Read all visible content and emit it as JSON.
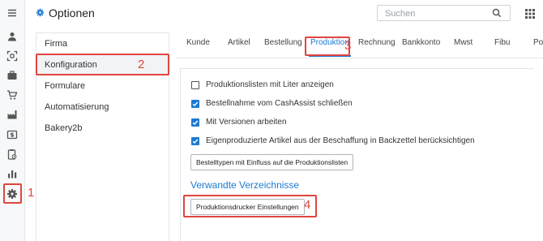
{
  "header": {
    "title": "Optionen",
    "search_placeholder": "Suchen"
  },
  "rail": {
    "icons": [
      "menu-icon",
      "user-icon",
      "scan-icon",
      "briefcase-icon",
      "cart-icon",
      "factory-icon",
      "cash-icon",
      "clipboard-clock-icon",
      "bar-chart-icon",
      "gear-icon"
    ]
  },
  "nav": {
    "items": [
      {
        "label": "Firma"
      },
      {
        "label": "Konfiguration"
      },
      {
        "label": "Formulare"
      },
      {
        "label": "Automatisierung"
      },
      {
        "label": "Bakery2b"
      }
    ]
  },
  "tabs": [
    {
      "label": "Kunde"
    },
    {
      "label": "Artikel"
    },
    {
      "label": "Bestellung"
    },
    {
      "label": "Produktion"
    },
    {
      "label": "Rechnung"
    },
    {
      "label": "Bankkonto"
    },
    {
      "label": "Mwst"
    },
    {
      "label": "Fibu"
    },
    {
      "label": "Po"
    }
  ],
  "options": [
    {
      "label": "Produktionslisten mit Liter anzeigen",
      "checked": false
    },
    {
      "label": "Bestellnahme vom CashAssist schließen",
      "checked": true
    },
    {
      "label": "Mit Versionen arbeiten",
      "checked": true
    },
    {
      "label": "Eigenproduzierte Artikel aus der Beschaffung in Backzettel berücksichtigen",
      "checked": true
    }
  ],
  "buttons": {
    "order_types": "Bestelltypen mit Einfluss auf die Produktionslisten",
    "printer_settings": "Produktionsdrucker Einstellungen"
  },
  "section": {
    "related_dirs": "Verwandte Verzeichnisse"
  },
  "annotations": {
    "n1": "1",
    "n2": "2",
    "n3": "3",
    "n4": "4"
  },
  "colors": {
    "accent": "#1f7ad1",
    "annotation": "#e0453f"
  }
}
